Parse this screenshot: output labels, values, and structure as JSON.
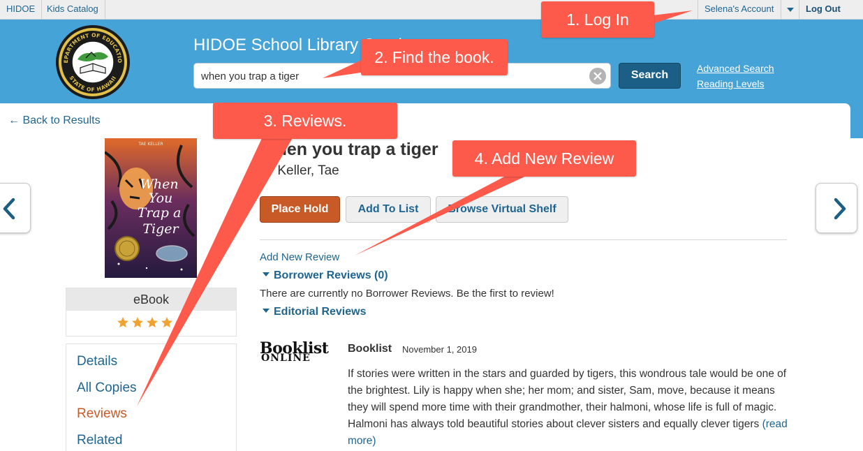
{
  "topbar": {
    "links": [
      "HIDOE",
      "Kids Catalog"
    ],
    "account_label": "Selena's Account",
    "logout_label": "Log Out"
  },
  "header": {
    "site_title": "HIDOE School Library Catalog",
    "search_value": "when you trap a tiger",
    "search_button": "Search",
    "advanced_search": "Advanced Search",
    "reading_levels": "Reading Levels",
    "seal_text_top": "DEPARTMENT OF EDUCATION",
    "seal_text_bottom": "STATE OF HAWAII"
  },
  "back_link": "← Back to Results",
  "book": {
    "title": "When you trap a tiger",
    "author": "by Keller, Tae",
    "cover_author": "TAE KELLER",
    "cover_title_lines": [
      "When",
      "You",
      "Trap a",
      "Tiger"
    ],
    "format": "eBook",
    "rating": 4.5,
    "rating_max": 5
  },
  "actions": {
    "place_hold": "Place Hold",
    "add_to_list": "Add To List",
    "browse_shelf": "Browse Virtual Shelf"
  },
  "side_nav": {
    "items": [
      "Details",
      "All Copies",
      "Reviews",
      "Related"
    ],
    "active_index": 2
  },
  "reviews": {
    "add_new": "Add New Review",
    "borrower_heading": "Borrower Reviews (0)",
    "no_reviews_text": "There are currently no Borrower Reviews. Be the first to review!",
    "editorial_heading": "Editorial Reviews",
    "editorial": {
      "logo_line1": "Booklist",
      "logo_line2": "ONLINE",
      "source": "Booklist",
      "date": "November 1, 2019",
      "text": "If stories were written in the stars and guarded by tigers, this wondrous tale would be one of the brightest. Lily is happy when she; her mom; and sister, Sam, move, because it means they will spend more time with their grandmother, their halmoni, whose life is full of magic. Halmoni has always told beautiful stories about clever sisters and equally clever tigers",
      "read_more": "(read more)"
    }
  },
  "callouts": {
    "step1": "1. Log In",
    "step2": "2. Find the book.",
    "step3": "3. Reviews.",
    "step4": "4. Add New Review"
  },
  "colors": {
    "header_blue": "#46a3d7",
    "callout_red": "#fd5a4b",
    "link_blue": "#1f6591",
    "hold_orange": "#c85a27"
  }
}
